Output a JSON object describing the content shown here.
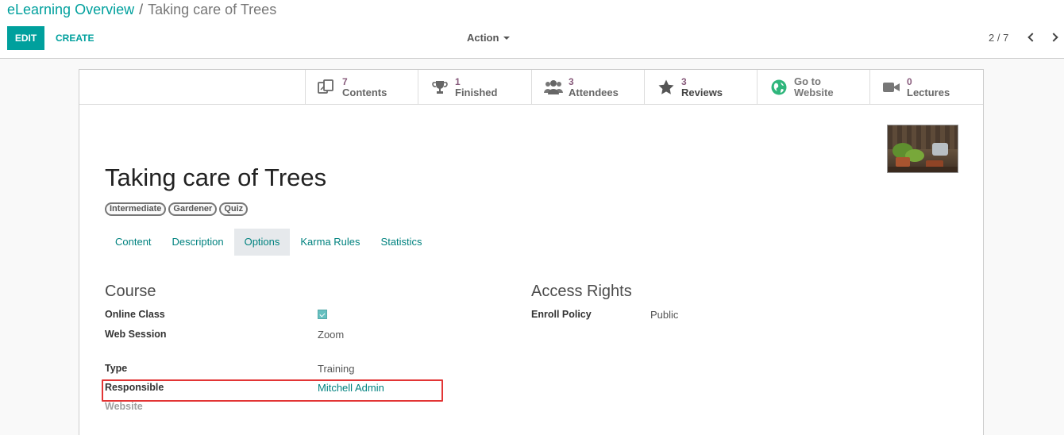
{
  "breadcrumb": {
    "parent": "eLearning Overview",
    "separator": "/",
    "current": "Taking care of Trees"
  },
  "toolbar": {
    "edit_label": "EDIT",
    "create_label": "CREATE",
    "action_label": "Action"
  },
  "pager": {
    "value": "2 / 7"
  },
  "stats": [
    {
      "number": "7",
      "label": "Contents",
      "icon": "contents-icon"
    },
    {
      "number": "1",
      "label": "Finished",
      "icon": "trophy-icon"
    },
    {
      "number": "3",
      "label": "Attendees",
      "icon": "users-icon"
    },
    {
      "number": "3",
      "label": "Reviews",
      "icon": "star-icon"
    },
    {
      "number": "Go to",
      "label": "Website",
      "icon": "globe-icon"
    },
    {
      "number": "0",
      "label": "Lectures",
      "icon": "video-camera-icon"
    }
  ],
  "course": {
    "title": "Taking care of Trees",
    "tags": [
      "Intermediate",
      "Gardener",
      "Quiz"
    ]
  },
  "tabs": [
    "Content",
    "Description",
    "Options",
    "Karma Rules",
    "Statistics"
  ],
  "active_tab": "Options",
  "sections": {
    "course": {
      "title": "Course",
      "online_class_label": "Online Class",
      "online_class_checked": true,
      "web_session_label": "Web Session",
      "web_session_value": "Zoom",
      "type_label": "Type",
      "type_value": "Training",
      "responsible_label": "Responsible",
      "responsible_value": "Mitchell Admin",
      "website_label": "Website"
    },
    "access": {
      "title": "Access Rights",
      "enroll_policy_label": "Enroll Policy",
      "enroll_policy_value": "Public"
    }
  },
  "colors": {
    "accent": "#00a09d",
    "stat_number": "#875a7b",
    "highlight": "#e23535"
  }
}
